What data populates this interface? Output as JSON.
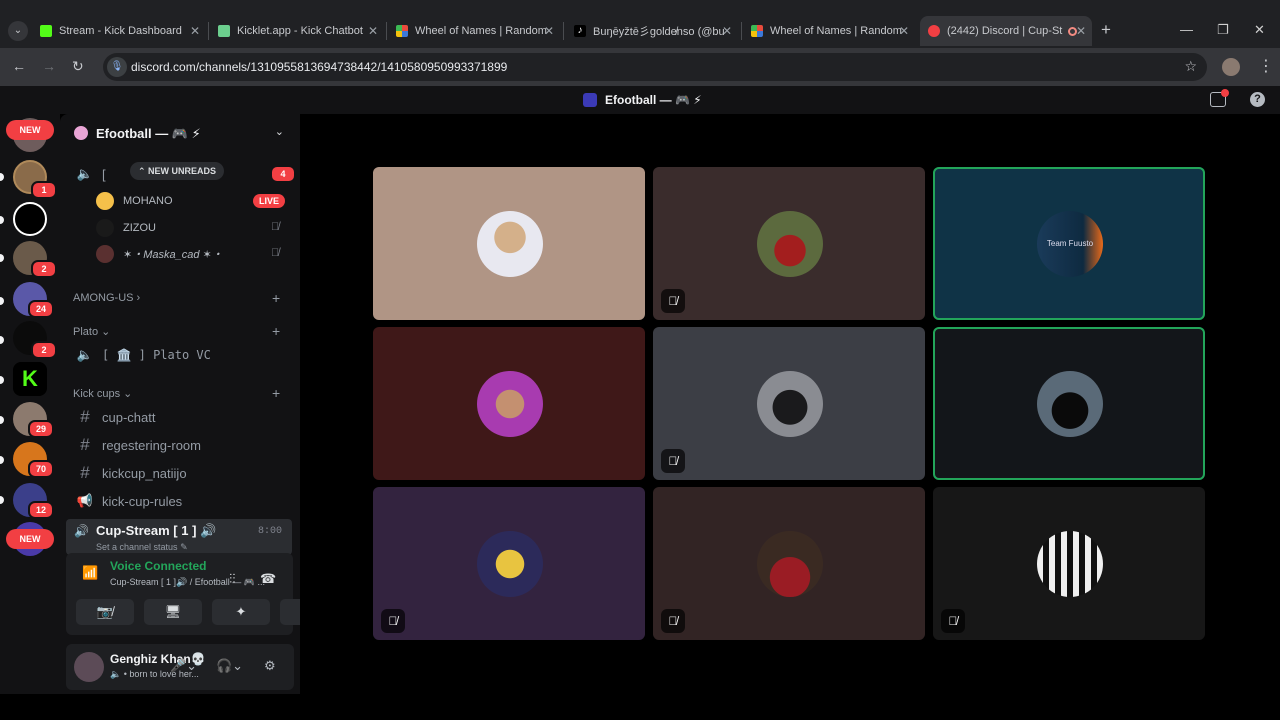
{
  "browser": {
    "tabs": [
      {
        "title": "Stream - Kick Dashboard",
        "color": "#53fc18"
      },
      {
        "title": "Kicklet.app - Kick Chatbot",
        "color": "#6ccf8e"
      },
      {
        "title": "Wheel of Names | Random",
        "color": "#e94b3c"
      },
      {
        "title": "Buŋēyžtē彡golde̸nso (@bu",
        "color": "#ffffff"
      },
      {
        "title": "Wheel of Names | Random",
        "color": "#e94b3c"
      },
      {
        "title": "(2442) Discord | Cup-St",
        "color": "#f23f43"
      }
    ],
    "url": "discord.com/channels/1310955813694738442/1410580950993371899"
  },
  "titlebar": {
    "server_title": "Efootball — 🎮 ⚡"
  },
  "rail": {
    "new_label": "NEW",
    "badges": [
      "1",
      "2",
      "24",
      "2",
      "29",
      "70",
      "12"
    ]
  },
  "sidebar": {
    "guild_name": "Efootball — 🎮 ⚡",
    "new_unreads": "NEW UNREADS",
    "voice_badge": "4",
    "members": [
      {
        "name": "MOHANO",
        "live": "LIVE"
      },
      {
        "name": "ZIZOU"
      },
      {
        "name": "✶・Maska_cad ✶・"
      }
    ],
    "categories": {
      "among_us": "AMONG-US",
      "plato": "Plato",
      "plato_vc": "[ 🏛️ ] Plato VC",
      "kick_cups": "Kick cups"
    },
    "channels": [
      "cup-chatt",
      "regestering-room",
      "kickcup_natiijo",
      "kick-cup-rules"
    ],
    "active_channel": {
      "name": "Cup-Stream [ 1 ] 🔊",
      "status": "Set a channel status",
      "timer": "8:00"
    }
  },
  "voice_panel": {
    "status": "Voice Connected",
    "location": "Cup-Stream [ 1 ]🔊 / Efootball — 🎮 ..."
  },
  "user": {
    "name": "Genghiz Khan💀",
    "status": "born to love her..."
  },
  "tiles": [
    {
      "bg": "#b09585",
      "speaking": false,
      "muted": false,
      "label": ""
    },
    {
      "bg": "#3a2c2c",
      "speaking": false,
      "muted": true,
      "label": ""
    },
    {
      "bg": "#0f3346",
      "speaking": true,
      "muted": false,
      "label": "Team Fuusto"
    },
    {
      "bg": "#3f1818",
      "speaking": false,
      "muted": false,
      "label": ""
    },
    {
      "bg": "#3c3e45",
      "speaking": false,
      "muted": true,
      "label": ""
    },
    {
      "bg": "#13161a",
      "speaking": true,
      "muted": false,
      "label": ""
    },
    {
      "bg": "#33233f",
      "speaking": false,
      "muted": true,
      "label": ""
    },
    {
      "bg": "#322424",
      "speaking": false,
      "muted": true,
      "label": ""
    },
    {
      "bg": "#171717",
      "speaking": false,
      "muted": true,
      "label": ""
    }
  ]
}
